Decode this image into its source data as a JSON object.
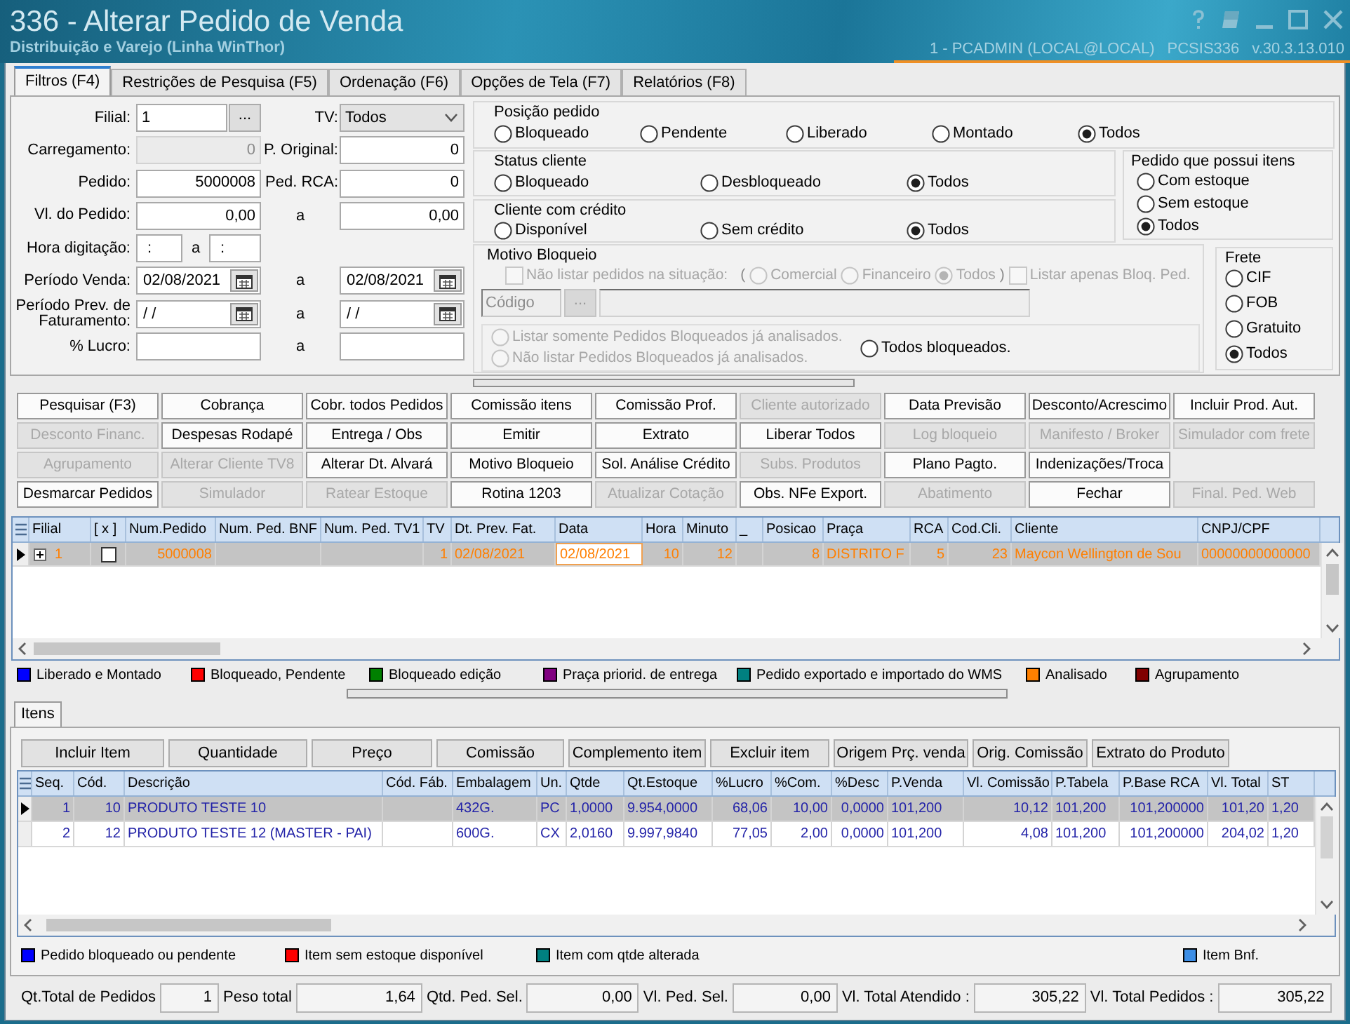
{
  "window": {
    "title": "336 - Alterar Pedido de Venda",
    "subtitle": "Distribuição e Varejo (Linha WinThor)",
    "session": "1 - PCADMIN (LOCAL@LOCAL)",
    "program": "PCSIS336",
    "version": "v.30.3.13.010"
  },
  "tabs": [
    {
      "label": "Filtros (F4)",
      "selected": true
    },
    {
      "label": "Restrições de Pesquisa (F5)",
      "selected": false
    },
    {
      "label": "Ordenação (F6)",
      "selected": false
    },
    {
      "label": "Opções de Tela (F7)",
      "selected": false
    },
    {
      "label": "Relatórios (F8)",
      "selected": false
    }
  ],
  "filter_rows": [
    {
      "label": "Filial:",
      "first": {
        "kind": "lookup",
        "value": "1",
        "button": "..."
      },
      "middle": {
        "kind": "label",
        "text": "TV:"
      },
      "second": {
        "kind": "select",
        "value": "Todos"
      }
    },
    {
      "label": "Carregamento:",
      "first": {
        "kind": "number",
        "value": "0",
        "disabled": true
      },
      "middle": {
        "kind": "label",
        "text": "P. Original:"
      },
      "second": {
        "kind": "number",
        "value": "0",
        "disabled": false
      }
    },
    {
      "label": "Pedido:",
      "first": {
        "kind": "number",
        "value": "5000008",
        "disabled": false
      },
      "middle": {
        "kind": "label",
        "text": "Ped. RCA:"
      },
      "second": {
        "kind": "number",
        "value": "0",
        "disabled": false
      }
    },
    {
      "label": "Vl. do Pedido:",
      "first": {
        "kind": "number",
        "value": "0,00",
        "disabled": false
      },
      "middle": {
        "kind": "joiner",
        "text": "a"
      },
      "second": {
        "kind": "number",
        "value": "0,00",
        "disabled": false
      }
    },
    {
      "label": "Hora digitação:",
      "first": {
        "kind": "time_pair",
        "start": ":",
        "joiner": "a",
        "end": ":"
      }
    },
    {
      "label": "Período Venda:",
      "first": {
        "kind": "date",
        "value": "02/08/2021"
      },
      "middle": {
        "kind": "joiner",
        "text": "a"
      },
      "second": {
        "kind": "date",
        "value": "02/08/2021"
      }
    },
    {
      "label": "Período Prev. de Faturamento:",
      "first": {
        "kind": "date",
        "value": "/ /"
      },
      "middle": {
        "kind": "joiner",
        "text": "a"
      },
      "second": {
        "kind": "date",
        "value": "/ /"
      }
    },
    {
      "label": "% Lucro:",
      "first": {
        "kind": "number",
        "disabled": false
      },
      "middle": {
        "kind": "joiner",
        "text": "a"
      },
      "second": {
        "kind": "number",
        "disabled": false
      }
    }
  ],
  "order_position": {
    "title": "Posição pedido",
    "options": [
      {
        "label": "Bloqueado",
        "selected": false
      },
      {
        "label": "Pendente",
        "selected": false
      },
      {
        "label": "Liberado",
        "selected": false
      },
      {
        "label": "Montado",
        "selected": false
      },
      {
        "label": "Todos",
        "selected": true
      }
    ]
  },
  "client_status": {
    "title": "Status cliente",
    "options": [
      {
        "label": "Bloqueado",
        "selected": false
      },
      {
        "label": "Desbloqueado",
        "selected": false
      },
      {
        "label": "Todos",
        "selected": true
      }
    ]
  },
  "client_credit": {
    "title": "Cliente com crédito",
    "options": [
      {
        "label": "Disponível",
        "selected": false
      },
      {
        "label": "Sem crédito",
        "selected": false
      },
      {
        "label": "Todos",
        "selected": true
      }
    ]
  },
  "items_stock": {
    "title": "Pedido que possui itens",
    "options": [
      {
        "label": "Com estoque",
        "selected": false
      },
      {
        "label": "Sem estoque",
        "selected": false
      },
      {
        "label": "Todos",
        "selected": true
      }
    ]
  },
  "block_reason": {
    "title": "Motivo Bloqueio",
    "exclude_check": {
      "label": "Não listar pedidos na situação:",
      "checked": false,
      "disabled": true
    },
    "open_paren": "(",
    "situations": [
      {
        "label": "Comercial",
        "selected": false,
        "disabled": true
      },
      {
        "label": "Financeiro",
        "selected": false,
        "disabled": true
      },
      {
        "label": "Todos",
        "selected": true,
        "disabled": true
      }
    ],
    "close_paren": ")",
    "only_blocked_check": {
      "label": "Listar apenas Bloq. Ped.",
      "checked": false,
      "disabled": true
    },
    "code_field": {
      "placeholder": "Código",
      "button": "...",
      "disabled": true
    },
    "analysis_options": [
      {
        "label": "Listar somente Pedidos Bloqueados já analisados.",
        "selected": false,
        "disabled": true
      },
      {
        "label": "Não listar Pedidos Bloqueados já analisados.",
        "selected": false,
        "disabled": true
      }
    ],
    "all_blocked": {
      "label": "Todos bloqueados.",
      "selected": false,
      "disabled": false
    }
  },
  "freight": {
    "title": "Frete",
    "options": [
      {
        "label": "CIF",
        "selected": false
      },
      {
        "label": "FOB",
        "selected": false
      },
      {
        "label": "Gratuito",
        "selected": false
      },
      {
        "label": "Todos",
        "selected": true
      }
    ]
  },
  "action_rows": [
    [
      {
        "label": "Pesquisar (F3)",
        "disabled": false
      },
      {
        "label": "Cobrança",
        "disabled": false
      },
      {
        "label": "Cobr. todos Pedidos",
        "disabled": false
      },
      {
        "label": "Comissão itens",
        "disabled": false
      },
      {
        "label": "Comissão Prof.",
        "disabled": false
      },
      {
        "label": "Cliente autorizado",
        "disabled": true
      },
      {
        "label": "Data Previsão",
        "disabled": false
      },
      {
        "label": "Desconto/Acrescimo",
        "disabled": false
      },
      {
        "label": "Incluir Prod. Aut.",
        "disabled": false
      }
    ],
    [
      {
        "label": "Desconto Financ.",
        "disabled": true
      },
      {
        "label": "Despesas Rodapé",
        "disabled": false
      },
      {
        "label": "Entrega / Obs",
        "disabled": false
      },
      {
        "label": "Emitir",
        "disabled": false
      },
      {
        "label": "Extrato",
        "disabled": false
      },
      {
        "label": "Liberar Todos",
        "disabled": false
      },
      {
        "label": "Log bloqueio",
        "disabled": true
      },
      {
        "label": "Manifesto / Broker",
        "disabled": true
      },
      {
        "label": "Simulador com frete",
        "disabled": true
      }
    ],
    [
      {
        "label": "Agrupamento",
        "disabled": true
      },
      {
        "label": "Alterar Cliente TV8",
        "disabled": true
      },
      {
        "label": "Alterar Dt. Alvará",
        "disabled": false
      },
      {
        "label": "Motivo Bloqueio",
        "disabled": false
      },
      {
        "label": "Sol. Análise Crédito",
        "disabled": false
      },
      {
        "label": "Subs. Produtos",
        "disabled": true
      },
      {
        "label": "Plano Pagto.",
        "disabled": false
      },
      {
        "label": "Indenizações/Troca",
        "disabled": false
      }
    ],
    [
      {
        "label": "Desmarcar Pedidos",
        "disabled": false
      },
      {
        "label": "Simulador",
        "disabled": true
      },
      {
        "label": "Ratear Estoque",
        "disabled": true
      },
      {
        "label": "Rotina 1203",
        "disabled": false
      },
      {
        "label": "Atualizar Cotação",
        "disabled": true
      },
      {
        "label": "Obs. NFe Export.",
        "disabled": false
      },
      {
        "label": "Abatimento",
        "disabled": true
      },
      {
        "label": "Fechar",
        "disabled": false
      },
      {
        "label": "Final. Ped. Web",
        "disabled": true
      }
    ]
  ],
  "orders_grid": {
    "columns": [
      {
        "label": "Filial",
        "kind": "text",
        "current": false
      },
      {
        "label": "[ x ]",
        "kind": "check",
        "current": false
      },
      {
        "label": "Num.Pedido",
        "kind": "text",
        "current": false
      },
      {
        "label": "Num. Ped. BNF",
        "kind": "text",
        "current": false
      },
      {
        "label": "Num. Ped. TV1",
        "kind": "text",
        "current": false
      },
      {
        "label": "TV",
        "kind": "text",
        "current": false
      },
      {
        "label": "Dt. Prev. Fat.",
        "kind": "text",
        "current": false
      },
      {
        "label": "Data",
        "kind": "text",
        "current": true
      },
      {
        "label": "Hora",
        "kind": "text",
        "current": false
      },
      {
        "label": "Minuto",
        "kind": "text",
        "current": false
      },
      {
        "label": "_",
        "kind": "text",
        "current": false
      },
      {
        "label": "Posicao",
        "kind": "text",
        "current": false
      },
      {
        "label": "Praça",
        "kind": "text",
        "current": false
      },
      {
        "label": "RCA",
        "kind": "text",
        "current": false
      },
      {
        "label": "Cod.Cli.",
        "kind": "text",
        "current": false
      },
      {
        "label": "Cliente",
        "kind": "text",
        "current": false
      },
      {
        "label": "CNPJ/CPF",
        "kind": "text",
        "current": false
      }
    ],
    "rows": [
      {
        "selected": true,
        "expanded": false,
        "checked": false,
        "cells": [
          "1",
          null,
          "5000008",
          null,
          null,
          "1",
          "02/08/2021",
          "02/08/2021",
          "10",
          "12",
          null,
          "8",
          "DISTRITO F",
          "5",
          "23",
          "Maycon Wellington de Sou",
          "00000000000000"
        ]
      }
    ]
  },
  "order_legend": [
    {
      "label": "Liberado e Montado",
      "color": "#0000ff"
    },
    {
      "label": "Bloqueado, Pendente",
      "color": "#ff0000"
    },
    {
      "label": "Bloqueado edição",
      "color": "#008000"
    },
    {
      "label": "Praça priorid. de entrega",
      "color": "#800080"
    },
    {
      "label": "Pedido exportado e importado do WMS",
      "color": "#008080"
    },
    {
      "label": "Analisado",
      "color": "#ff8000"
    },
    {
      "label": "Agrupamento",
      "color": "#800000"
    }
  ],
  "item_tabs": [
    {
      "label": "Itens",
      "selected": true
    }
  ],
  "item_actions": [
    "Incluir Item",
    "Quantidade",
    "Preço",
    "Comissão",
    "Complemento item",
    "Excluir item",
    "Origem Prç. venda",
    "Orig. Comissão",
    "Extrato do Produto"
  ],
  "items_grid": {
    "columns": [
      "Seq.",
      "Cód.",
      "Descrição",
      "Cód. Fáb.",
      "Embalagem",
      "Un.",
      "Qtde",
      "Qt.Estoque",
      "%Lucro",
      "%Com.",
      "%Desc",
      "P.Venda",
      "Vl. Comissão",
      "P.Tabela",
      "P.Base RCA",
      "Vl. Total",
      "ST"
    ],
    "rows": [
      {
        "selected": true,
        "cells": [
          "1",
          "10",
          "PRODUTO TESTE 10",
          null,
          "432G.",
          "PC",
          "1,0000",
          "9.954,0000",
          "68,06",
          "10,00",
          "0,0000",
          "101,200",
          "10,12",
          "101,200",
          "101,200000",
          "101,20",
          "1,20"
        ]
      },
      {
        "selected": false,
        "cells": [
          "2",
          "12",
          "PRODUTO TESTE 12 (MASTER - PAI)",
          null,
          "600G.",
          "CX",
          "2,0160",
          "9.997,9840",
          "77,05",
          "2,00",
          "0,0000",
          "101,200",
          "4,08",
          "101,200",
          "101,200000",
          "204,02",
          "1,20"
        ]
      }
    ]
  },
  "item_legend": [
    {
      "label": "Pedido bloqueado ou pendente",
      "color": "#0000ff"
    },
    {
      "label": "Item sem estoque disponível",
      "color": "#ff0000"
    },
    {
      "label": "Item com qtde alterada",
      "color": "#008080"
    },
    {
      "label": "Item Bnf.",
      "color": "#3c8ee6"
    }
  ],
  "totals": [
    {
      "label": "Qt.Total de Pedidos",
      "value": "1"
    },
    {
      "label": "Peso total",
      "value": "1,64"
    },
    {
      "label": "Qtd. Ped. Sel.",
      "value": "0,00"
    },
    {
      "label": "Vl. Ped. Sel.",
      "value": "0,00"
    },
    {
      "label": "Vl. Total Atendido :",
      "value": "305,22"
    },
    {
      "label": "Vl. Total Pedidos :",
      "value": "305,22"
    }
  ]
}
